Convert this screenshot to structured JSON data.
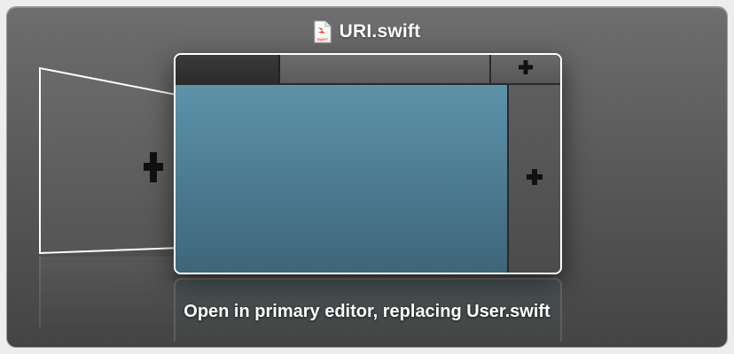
{
  "title": {
    "filename": "URI.swift",
    "icon": "swift-file-icon",
    "icon_badge": "SWIFT"
  },
  "caption": "Open in primary editor, replacing User.swift",
  "colors": {
    "editor_tint": "#5d93aa",
    "hud_background": "#5a5a5a",
    "swift_orange": "#f05138"
  }
}
